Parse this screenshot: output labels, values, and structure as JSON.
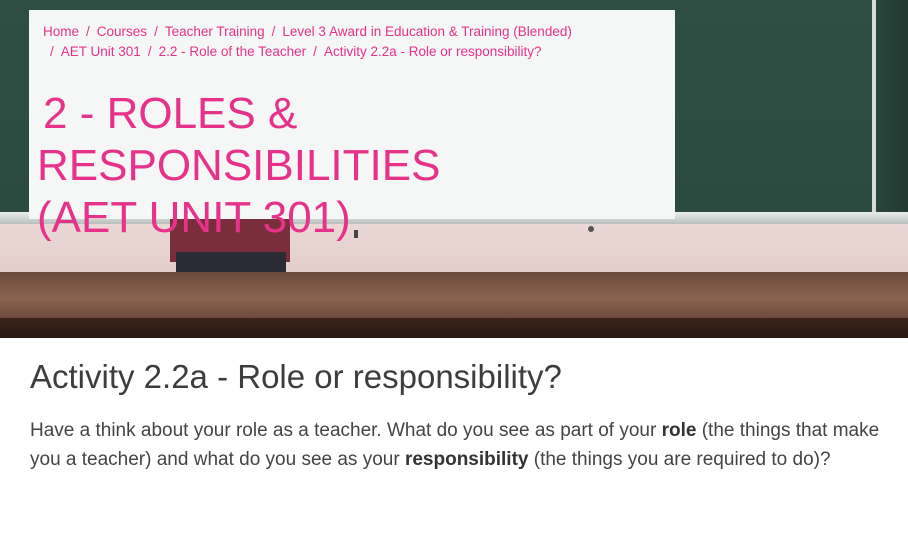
{
  "breadcrumb": {
    "items": [
      "Home",
      "Courses",
      "Teacher Training",
      "Level 3 Award in Education & Training (Blended)",
      "AET Unit 301",
      "2.2 - Role of the Teacher",
      "Activity 2.2a - Role or responsibility?"
    ],
    "separator": "/"
  },
  "page": {
    "title_line1": "2 - ROLES & RESPONSIBILITIES",
    "title_line2": "(AET UNIT 301)"
  },
  "activity": {
    "heading": "Activity 2.2a - Role or responsibility?",
    "text_1": "Have a think about your role as a teacher. What do you see as part of your ",
    "bold_1": "role",
    "text_2": " (the things that make you a teacher) and what do you see as your ",
    "bold_2": "responsibility",
    "text_3": " (the things you are required to do)?"
  },
  "colors": {
    "accent": "#e6328a",
    "panel_bg": "#f5f6f6",
    "heading_text": "#3d3d3d"
  }
}
